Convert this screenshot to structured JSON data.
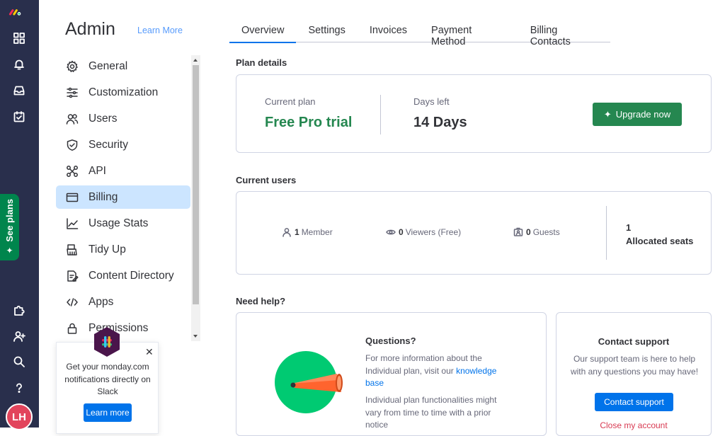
{
  "rail": {
    "see_plans": "See plans",
    "avatar": "LH"
  },
  "admin": {
    "title": "Admin",
    "learn_more": "Learn More"
  },
  "menu": [
    {
      "label": "General",
      "icon": "gear-icon"
    },
    {
      "label": "Customization",
      "icon": "sliders-icon"
    },
    {
      "label": "Users",
      "icon": "users-icon"
    },
    {
      "label": "Security",
      "icon": "shield-icon"
    },
    {
      "label": "API",
      "icon": "api-icon"
    },
    {
      "label": "Billing",
      "icon": "credit-card-icon",
      "active": true
    },
    {
      "label": "Usage Stats",
      "icon": "chart-line-icon"
    },
    {
      "label": "Tidy Up",
      "icon": "broom-icon"
    },
    {
      "label": "Content Directory",
      "icon": "document-icon"
    },
    {
      "label": "Apps",
      "icon": "code-icon"
    },
    {
      "label": "Permissions",
      "icon": "lock-icon"
    }
  ],
  "slack": {
    "message": "Get your monday.com notifications directly on Slack",
    "button": "Learn more"
  },
  "tabs": [
    "Overview",
    "Settings",
    "Invoices",
    "Payment Method",
    "Billing Contacts"
  ],
  "plan": {
    "section_title": "Plan details",
    "current_plan_label": "Current plan",
    "current_plan_value": "Free Pro trial",
    "days_left_label": "Days left",
    "days_left_value": "14 Days",
    "upgrade_button": "Upgrade now"
  },
  "users": {
    "section_title": "Current users",
    "members_count": "1",
    "members_label": "Member",
    "viewers_count": "0",
    "viewers_label": "Viewers (Free)",
    "guests_count": "0",
    "guests_label": "Guests",
    "allocated_count": "1",
    "allocated_label": "Allocated seats"
  },
  "help": {
    "section_title": "Need help?",
    "questions_title": "Questions?",
    "questions_text_before": "For more information about the Individual plan, visit our",
    "questions_link": "knowledge base",
    "questions_text_2": "Individual plan functionalities might vary from time to time with a prior notice",
    "contact_title": "Contact support",
    "contact_text": "Our support team is here to help with any questions you may have!",
    "contact_button": "Contact support",
    "close_account": "Close my account"
  },
  "colors": {
    "rail_bg": "#292f4c",
    "primary": "#0073ea",
    "green": "#258750",
    "active_menu": "#cce5ff"
  }
}
